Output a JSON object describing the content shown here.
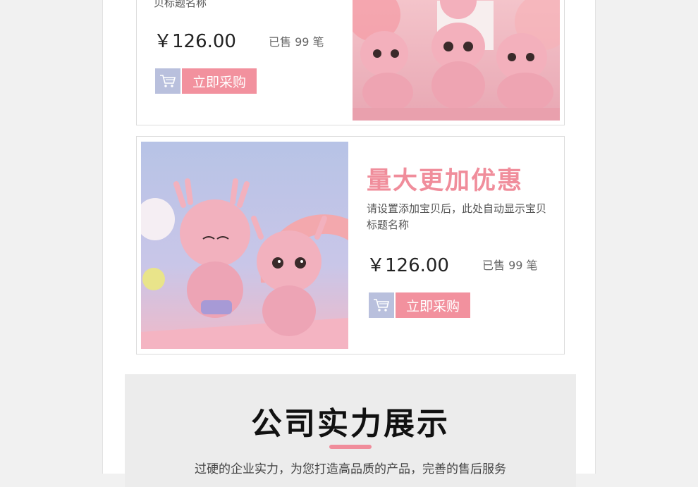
{
  "product_top": {
    "desc_tail": "贝标题名称",
    "price": "￥126.00",
    "sold": "已售 99 笔",
    "buy_label": "立即采购"
  },
  "product_bottom": {
    "title": "量大更加优惠",
    "desc": "请设置添加宝贝后，此处自动显示宝贝标题名称",
    "price": "￥126.00",
    "sold": "已售 99 笔",
    "buy_label": "立即采购"
  },
  "company": {
    "title": "公司实力展示",
    "subtitle": "过硬的企业实力，为您打造高品质的产品，完善的售后服务"
  },
  "colors": {
    "accent": "#f08d9b",
    "cart_bg": "#b9c0dd"
  }
}
